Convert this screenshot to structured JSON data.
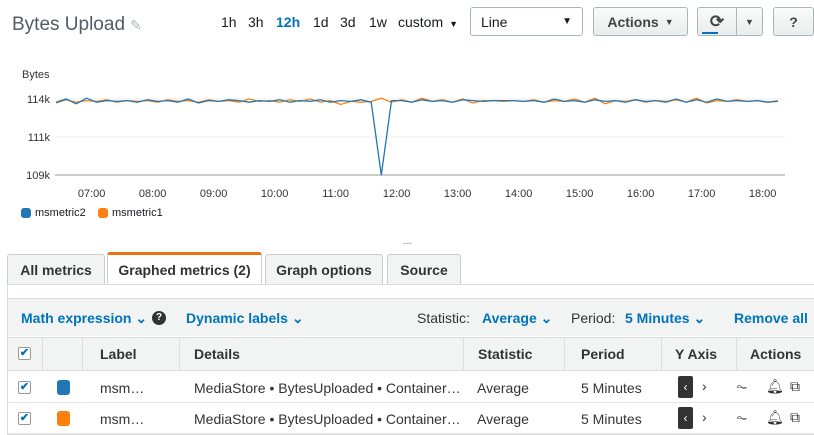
{
  "header": {
    "title": "Bytes Upload",
    "time_ranges": [
      "1h",
      "3h",
      "12h",
      "1d",
      "3d",
      "1w"
    ],
    "active_range": "12h",
    "custom_label": "custom",
    "chart_type": "Line",
    "actions_label": "Actions"
  },
  "chart_data": {
    "type": "line",
    "title": "Bytes Upload",
    "ylabel": "Bytes",
    "xlabel": "",
    "yticks": [
      {
        "value": 109.1,
        "label": "109k"
      },
      {
        "value": 111.5,
        "label": "111k"
      },
      {
        "value": 113.9,
        "label": "114k"
      }
    ],
    "ylim": [
      109.1,
      114.2
    ],
    "xticks": [
      "07:00",
      "08:00",
      "09:00",
      "10:00",
      "11:00",
      "12:00",
      "13:00",
      "14:00",
      "15:00",
      "16:00",
      "17:00",
      "18:00"
    ],
    "x_start": "06:25",
    "x_step_minutes": 10,
    "series": [
      {
        "name": "msmetric2",
        "color": "#1f77b4",
        "values": [
          113.7,
          113.9,
          113.6,
          113.95,
          113.7,
          113.8,
          113.75,
          113.8,
          113.7,
          113.85,
          113.75,
          113.8,
          113.7,
          113.9,
          113.65,
          113.8,
          113.75,
          113.85,
          113.8,
          113.7,
          113.8,
          113.75,
          113.85,
          113.7,
          113.8,
          113.75,
          113.85,
          113.7,
          113.8,
          113.75,
          113.85,
          113.7,
          109.1,
          113.8,
          113.8,
          113.7,
          113.85,
          113.75,
          113.8,
          113.7,
          113.85,
          113.8,
          113.75,
          113.8,
          113.8,
          113.8,
          113.75,
          113.8,
          113.7,
          113.9,
          113.75,
          113.8,
          113.7,
          113.85,
          113.75,
          113.8,
          113.7,
          113.85,
          113.75,
          113.8,
          113.7,
          113.9,
          113.7,
          113.85,
          113.7,
          113.9,
          113.75,
          113.8,
          113.75,
          113.8,
          113.7,
          113.75
        ]
      },
      {
        "name": "msmetric1",
        "color": "#ff7f0e",
        "values": [
          113.65,
          113.85,
          113.7,
          113.8,
          113.75,
          113.85,
          113.7,
          113.8,
          113.75,
          113.8,
          113.7,
          113.85,
          113.75,
          113.8,
          113.7,
          113.85,
          113.75,
          113.8,
          113.7,
          113.9,
          113.75,
          113.8,
          113.7,
          113.85,
          113.75,
          113.9,
          113.7,
          113.8,
          113.55,
          113.75,
          113.7,
          113.75,
          113.95,
          113.7,
          113.85,
          113.7,
          113.95,
          113.75,
          113.85,
          113.7,
          113.9,
          113.65,
          113.8,
          113.8,
          113.75,
          113.8,
          113.75,
          113.85,
          113.7,
          113.8,
          113.75,
          113.9,
          113.7,
          113.95,
          113.6,
          113.8,
          113.75,
          113.85,
          113.7,
          113.8,
          113.75,
          113.85,
          113.7,
          113.95,
          113.65,
          113.8,
          113.75,
          113.85,
          113.75,
          113.8,
          113.7,
          113.8
        ]
      }
    ],
    "legend": "bottom-left",
    "grid": true
  },
  "tabs": [
    "All metrics",
    "Graphed metrics (2)",
    "Graph options",
    "Source"
  ],
  "toolbar": {
    "math_expression": "Math expression",
    "dynamic_labels": "Dynamic labels",
    "statistic_label": "Statistic:",
    "statistic_value": "Average",
    "period_label": "Period:",
    "period_value": "5 Minutes",
    "remove_all": "Remove all"
  },
  "table": {
    "headers": [
      "Label",
      "Details",
      "Statistic",
      "Period",
      "Y Axis",
      "Actions"
    ],
    "rows": [
      {
        "color": "#1f77b4",
        "label": "msm…",
        "details": "MediaStore • BytesUploaded • Container…",
        "statistic": "Average",
        "period": "5 Minutes"
      },
      {
        "color": "#ff7f0e",
        "label": "msm…",
        "details": "MediaStore • BytesUploaded • Container…",
        "statistic": "Average",
        "period": "5 Minutes"
      }
    ]
  },
  "divider": "---"
}
